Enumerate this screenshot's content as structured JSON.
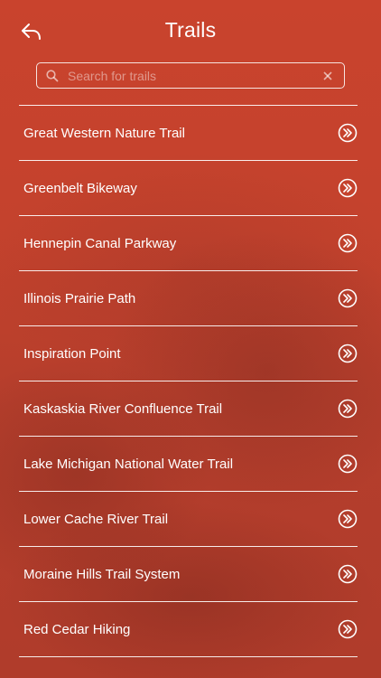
{
  "header": {
    "title": "Trails",
    "back_icon": "back-arrow-icon"
  },
  "search": {
    "placeholder": "Search for trails",
    "value": "",
    "search_icon": "search-icon",
    "clear_icon": "clear-icon"
  },
  "trails": [
    {
      "label": "Great Western Nature Trail"
    },
    {
      "label": "Greenbelt Bikeway"
    },
    {
      "label": "Hennepin Canal Parkway"
    },
    {
      "label": "Illinois Prairie Path"
    },
    {
      "label": "Inspiration Point"
    },
    {
      "label": "Kaskaskia River Confluence Trail"
    },
    {
      "label": "Lake Michigan National Water Trail"
    },
    {
      "label": "Lower Cache River Trail"
    },
    {
      "label": "Moraine Hills Trail System"
    },
    {
      "label": "Red Cedar Hiking"
    }
  ],
  "colors": {
    "background": "#c0412c",
    "foreground": "#ffffff"
  }
}
